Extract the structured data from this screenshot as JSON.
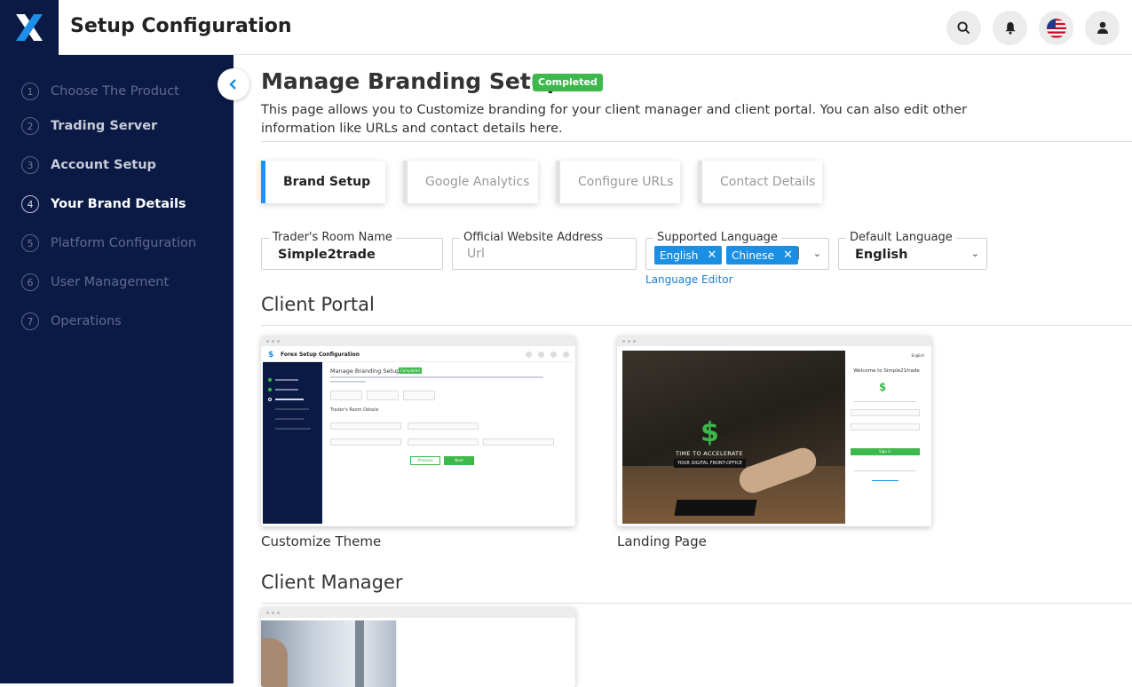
{
  "header": {
    "title": "Setup Configuration"
  },
  "sidebar": {
    "steps": [
      {
        "num": "1",
        "label": "Choose The Product"
      },
      {
        "num": "2",
        "label": "Trading Server"
      },
      {
        "num": "3",
        "label": "Account Setup"
      },
      {
        "num": "4",
        "label": "Your Brand Details"
      },
      {
        "num": "5",
        "label": "Platform Configuration"
      },
      {
        "num": "6",
        "label": "User Management"
      },
      {
        "num": "7",
        "label": "Operations"
      }
    ]
  },
  "main": {
    "title": "Manage Branding Setup",
    "status_badge": "Completed",
    "description": "This page allows you to Customize branding for your client manager and client portal. You can also edit other information like URLs and contact details here.",
    "tabs": [
      {
        "label": "Brand Setup"
      },
      {
        "label": "Google Analytics"
      },
      {
        "label": "Configure URLs"
      },
      {
        "label": "Contact Details"
      }
    ],
    "fields": {
      "traders_room": {
        "label": "Trader's Room Name",
        "value": "Simple2trade"
      },
      "website": {
        "label": "Official Website Address",
        "placeholder": "Url"
      },
      "supported_language": {
        "label": "Supported Language",
        "chips": [
          "English",
          "Chinese"
        ]
      },
      "default_language": {
        "label": "Default Language",
        "value": "English"
      }
    },
    "language_editor": "Language Editor",
    "client_portal": {
      "title": "Client Portal",
      "cards": [
        {
          "caption": "Customize Theme"
        },
        {
          "caption": "Landing Page"
        }
      ]
    },
    "client_manager": {
      "title": "Client Manager"
    }
  },
  "previews": {
    "theme": {
      "app_title": "Forex Setup Configuration",
      "page_title": "Manage Branding Setup",
      "badge": "Completed",
      "section": "Trader's Room Details",
      "prev": "Previous",
      "next": "Next"
    },
    "landing": {
      "headline": "TIME TO ACCELERATE",
      "subline": "YOUR DIGITAL FRONT-OFFICE",
      "welcome": "Welcome to Simple21trade",
      "lang": "English",
      "signin": "Sign in"
    }
  }
}
